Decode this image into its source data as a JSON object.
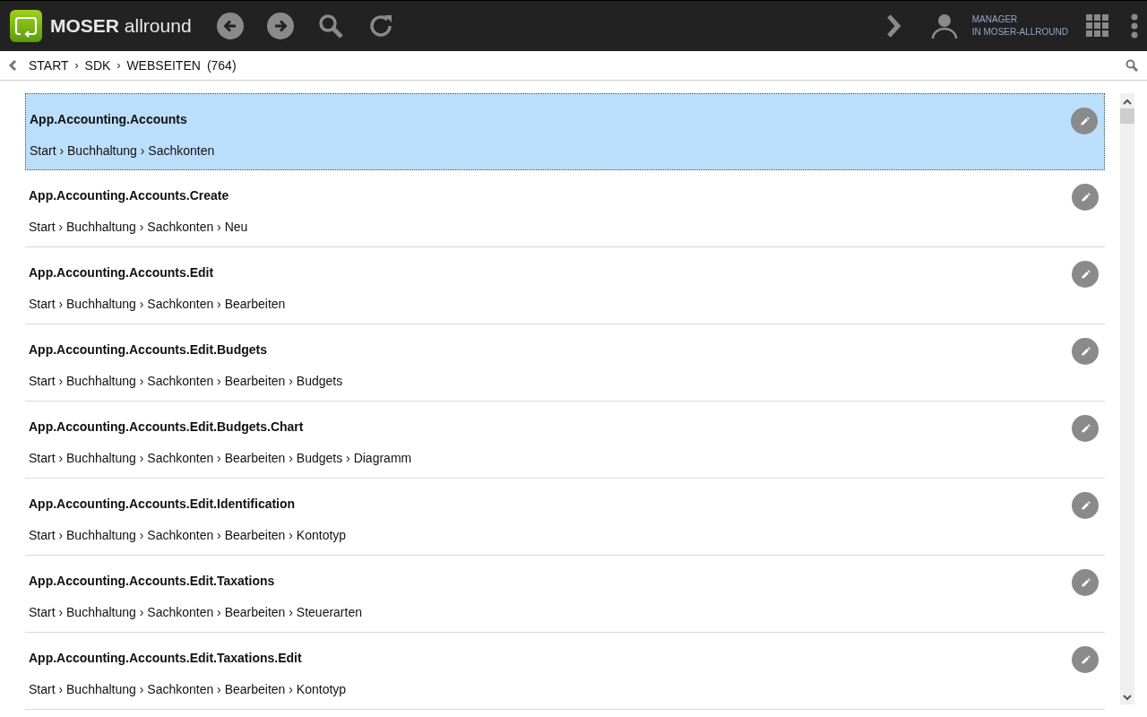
{
  "header": {
    "brand_bold": "MOSER",
    "brand_light": "allround",
    "user_role": "MANAGER",
    "user_company": "IN MOSER-ALLROUND"
  },
  "breadcrumb": {
    "items": [
      "START",
      "SDK",
      "WEBSEITEN"
    ],
    "separator": "›",
    "count": "(764)"
  },
  "rows": [
    {
      "name": "App.Accounting.Accounts",
      "path": "Start › Buchhaltung › Sachkonten",
      "selected": true
    },
    {
      "name": "App.Accounting.Accounts.Create",
      "path": "Start › Buchhaltung › Sachkonten › Neu",
      "selected": false
    },
    {
      "name": "App.Accounting.Accounts.Edit",
      "path": "Start › Buchhaltung › Sachkonten › Bearbeiten",
      "selected": false
    },
    {
      "name": "App.Accounting.Accounts.Edit.Budgets",
      "path": "Start › Buchhaltung › Sachkonten › Bearbeiten › Budgets",
      "selected": false
    },
    {
      "name": "App.Accounting.Accounts.Edit.Budgets.Chart",
      "path": "Start › Buchhaltung › Sachkonten › Bearbeiten › Budgets › Diagramm",
      "selected": false
    },
    {
      "name": "App.Accounting.Accounts.Edit.Identification",
      "path": "Start › Buchhaltung › Sachkonten › Bearbeiten › Kontotyp",
      "selected": false
    },
    {
      "name": "App.Accounting.Accounts.Edit.Taxations",
      "path": "Start › Buchhaltung › Sachkonten › Bearbeiten › Steuerarten",
      "selected": false
    },
    {
      "name": "App.Accounting.Accounts.Edit.Taxations.Edit",
      "path": "Start › Buchhaltung › Sachkonten › Bearbeiten › Kontotyp",
      "selected": false
    }
  ]
}
